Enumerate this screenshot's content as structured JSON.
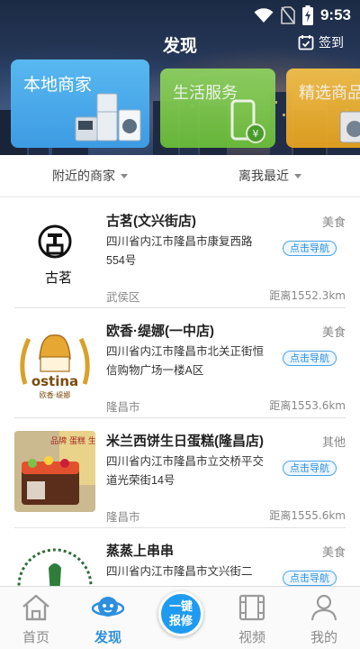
{
  "status_bar": {
    "time": "9:53"
  },
  "nav": {
    "title": "发现",
    "checkin_label": "签到"
  },
  "categories": [
    {
      "label": "本地商家"
    },
    {
      "label": "生活服务"
    },
    {
      "label": "精选商品"
    }
  ],
  "filters": [
    {
      "label": "附近的商家"
    },
    {
      "label": "离我最近"
    }
  ],
  "merchants": [
    {
      "name": "古茗(文兴街店)",
      "category": "美食",
      "address": "四川省内江市隆昌市康复西路554号",
      "nav_label": "点击导航",
      "district": "武侯区",
      "distance": "距离1552.3km"
    },
    {
      "name": "欧香·缇娜(一中店)",
      "category": "美食",
      "address": "四川省内江市隆昌市北关正街恒信购物广场一楼A区",
      "nav_label": "点击导航",
      "district": "隆昌市",
      "distance": "距离1553.6km"
    },
    {
      "name": "米兰西饼生日蛋糕(隆昌店)",
      "category": "其他",
      "address": "四川省内江市隆昌市立交桥平交道光荣街14号",
      "nav_label": "点击导航",
      "district": "隆昌市",
      "distance": "距离1555.6km"
    },
    {
      "name": "蒸蒸上串串",
      "category": "美食",
      "address": "四川省内江市隆昌市文兴街二",
      "nav_label": "点击导航",
      "district": "",
      "distance": ""
    }
  ],
  "logos": {
    "guming_text": "古茗",
    "ostina_text": "ostina",
    "ostina_sub": "欧香·缇娜",
    "milan_sign": "品牌 蛋糕 生日"
  },
  "tabs": [
    {
      "label": "首页",
      "active": false
    },
    {
      "label": "发现",
      "active": true
    },
    {
      "label": "视频",
      "active": false
    },
    {
      "label": "我的",
      "active": false
    }
  ],
  "fab": {
    "line1": "一键",
    "line2": "报修"
  },
  "colors": {
    "accent": "#2d8fde",
    "local": "#3d9be3",
    "life": "#6bbd3a",
    "select": "#e6a21f"
  }
}
